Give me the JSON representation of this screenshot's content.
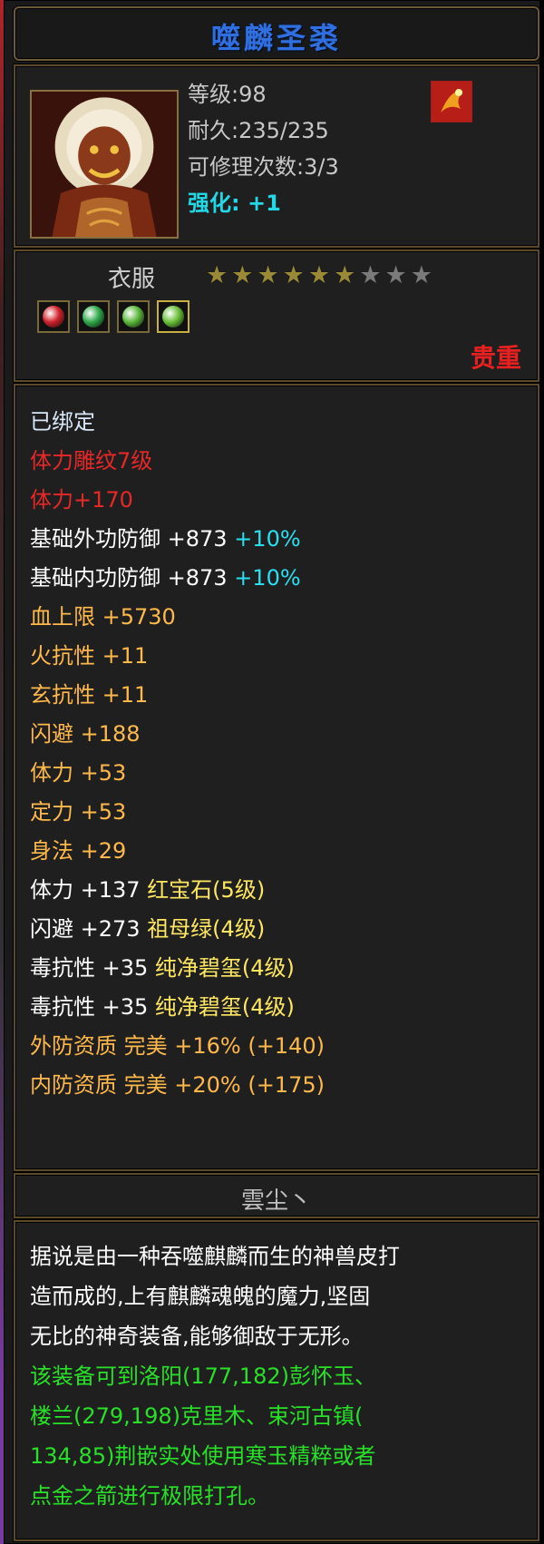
{
  "item": {
    "name": "噬麟圣裘",
    "level": "等级:98",
    "durability": "耐久:235/235",
    "repairs": "可修理次数:3/3",
    "enhance_label": "强化:",
    "enhance_value": "+1",
    "type": "衣服",
    "stars_total": 9,
    "stars_filled": 6,
    "rarity": "贵重",
    "gems": [
      {
        "icon": "ruby-gem-icon",
        "color": "#d0202a"
      },
      {
        "icon": "emerald-gem-icon",
        "color": "#2ea84a"
      },
      {
        "icon": "jade-gem-icon",
        "color": "#5ab83a"
      },
      {
        "icon": "jade-gem-icon",
        "color": "#6ac038"
      }
    ]
  },
  "attributes": [
    {
      "parts": [
        {
          "text": "已绑定",
          "cls": "c-white"
        }
      ]
    },
    {
      "parts": [
        {
          "text": "体力雕纹7级",
          "cls": "c-red"
        }
      ]
    },
    {
      "parts": [
        {
          "text": "体力+170",
          "cls": "c-red"
        }
      ]
    },
    {
      "parts": [
        {
          "text": "基础外功防御 +873 ",
          "cls": "c-base"
        },
        {
          "text": "+10%",
          "cls": "c-cyan"
        }
      ]
    },
    {
      "parts": [
        {
          "text": "基础内功防御 +873 ",
          "cls": "c-base"
        },
        {
          "text": "+10%",
          "cls": "c-cyan"
        }
      ]
    },
    {
      "parts": [
        {
          "text": "血上限 +5730",
          "cls": "c-orange"
        }
      ]
    },
    {
      "parts": [
        {
          "text": "火抗性 +11",
          "cls": "c-orange"
        }
      ]
    },
    {
      "parts": [
        {
          "text": "玄抗性 +11",
          "cls": "c-orange"
        }
      ]
    },
    {
      "parts": [
        {
          "text": "闪避 +188",
          "cls": "c-orange"
        }
      ]
    },
    {
      "parts": [
        {
          "text": "体力 +53",
          "cls": "c-orange"
        }
      ]
    },
    {
      "parts": [
        {
          "text": "定力 +53",
          "cls": "c-orange"
        }
      ]
    },
    {
      "parts": [
        {
          "text": "身法 +29",
          "cls": "c-orange"
        }
      ]
    },
    {
      "parts": [
        {
          "text": "体力 +137 ",
          "cls": "c-base"
        },
        {
          "text": "红宝石(5级)",
          "cls": "c-yellow"
        }
      ]
    },
    {
      "parts": [
        {
          "text": "闪避 +273 ",
          "cls": "c-base"
        },
        {
          "text": "祖母绿(4级)",
          "cls": "c-yellow"
        }
      ]
    },
    {
      "parts": [
        {
          "text": "毒抗性 +35 ",
          "cls": "c-base"
        },
        {
          "text": "纯净碧玺(4级)",
          "cls": "c-yellow"
        }
      ]
    },
    {
      "parts": [
        {
          "text": "毒抗性 +35 ",
          "cls": "c-base"
        },
        {
          "text": "纯净碧玺(4级)",
          "cls": "c-yellow"
        }
      ]
    },
    {
      "parts": [
        {
          "text": "外防资质  完美 +16% (+140)",
          "cls": "c-orange"
        }
      ]
    },
    {
      "parts": [
        {
          "text": "内防资质  完美 +20% (+175)",
          "cls": "c-orange"
        }
      ]
    }
  ],
  "author": "雲尘丶",
  "description": [
    {
      "text": "据说是由一种吞噬麒麟而生的神兽皮打",
      "cls": "w"
    },
    {
      "text": "造而成的,上有麒麟魂魄的魔力,坚固",
      "cls": "w"
    },
    {
      "text": "无比的神奇装备,能够御敌于无形。",
      "cls": "w"
    },
    {
      "text": "该装备可到洛阳(177,182)彭怀玉、",
      "cls": "g"
    },
    {
      "text": "楼兰(279,198)克里木、束河古镇(",
      "cls": "g"
    },
    {
      "text": "134,85)荆嵌实处使用寒玉精粹或者",
      "cls": "g"
    },
    {
      "text": "点金之箭进行极限打孔。",
      "cls": "g"
    }
  ]
}
